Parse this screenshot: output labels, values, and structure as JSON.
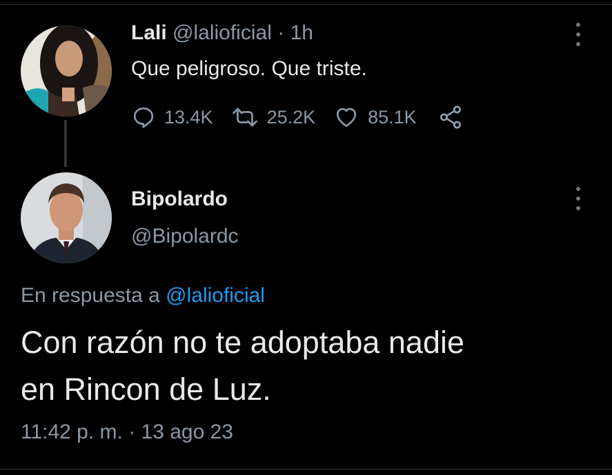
{
  "tweet1": {
    "name": "Lali",
    "handle": "@lalioficial",
    "separator": "·",
    "time": "1h",
    "text": "Que peligroso. Que triste.",
    "replies": "13.4K",
    "retweets": "25.2K",
    "likes": "85.1K"
  },
  "tweet2": {
    "name": "Bipolardo",
    "handle": "@Bipolardc",
    "reply_prefix": "En respuesta a",
    "reply_mention": "@lalioficial",
    "text_line1": "Con razón no te adoptaba nadie",
    "text_line2": "en Rincon de Luz.",
    "timestamp": "11:42 p. m. · 13 ago 23"
  },
  "icons": {
    "reply": "reply-icon",
    "retweet": "retweet-icon",
    "like": "heart-icon",
    "share": "share-icon",
    "more": "more-vertical-icon"
  },
  "colors": {
    "background": "#000000",
    "text": "#e7e9ea",
    "secondary": "#8b98a5",
    "link": "#1d9bf0",
    "divider": "#2f3336"
  }
}
